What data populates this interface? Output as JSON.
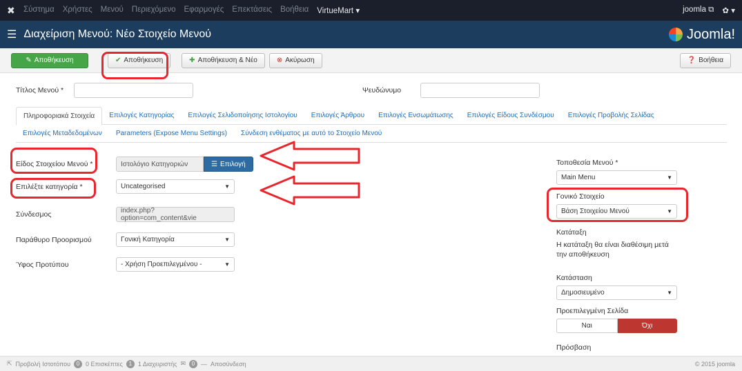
{
  "topbar": {
    "menu": [
      "Σύστημα",
      "Χρήστες",
      "Μενού",
      "Περιεχόμενο",
      "Εφαρμογές",
      "Επεκτάσεις",
      "Βοήθεια"
    ],
    "virtuemart": "VirtueMart ▾",
    "site_link": "joomla ⧉",
    "settings": "✿ ▾"
  },
  "titlebar": {
    "title": "Διαχείριση Μενού: Νέο Στοιχείο Μενού",
    "brand": "Joomla!"
  },
  "toolbar": {
    "save_close": "Αποθήκευση",
    "save": "Αποθήκευση",
    "save_new": "Αποθήκευση & Νέο",
    "cancel": "Ακύρωση",
    "help": "Βοήθεια"
  },
  "form": {
    "title_label": "Τίτλος Μενού *",
    "title_value": "",
    "alias_label": "Ψευδώνυμο",
    "alias_value": ""
  },
  "tabs_row1": [
    "Πληροφοριακά Στοιχεία",
    "Επιλογές Κατηγορίας",
    "Επιλογές Σελιδοποίησης Ιστολογίου",
    "Επιλογές Άρθρου",
    "Επιλογές Ενσωμάτωσης",
    "Επιλογές Είδους Συνδέσμου",
    "Επιλογές Προβολής Σελίδας"
  ],
  "tabs_row2": [
    "Επιλογές Μεταδεδομένων",
    "Parameters (Expose Menu Settings)",
    "Σύνδεση ενθέματος με αυτό το Στοιχείο Μενού"
  ],
  "fields": {
    "type_label": "Είδος Στοιχείου Μενού *",
    "type_value": "Ιστολόγιο Κατηγοριών",
    "type_button": "Επιλογή",
    "category_label": "Επιλέξτε κατηγορία *",
    "category_value": "Uncategorised",
    "link_label": "Σύνδεσμος",
    "link_value": "index.php?option=com_content&vie",
    "target_label": "Παράθυρο Προορισμού",
    "target_value": "Γονική Κατηγορία",
    "style_label": "Ύφος Προτύπου",
    "style_value": "- Χρήση Προεπιλεγμένου -"
  },
  "side": {
    "location_label": "Τοποθεσία Μενού *",
    "location_value": "Main Menu",
    "parent_label": "Γονικό Στοιχείο",
    "parent_value": "Βάση Στοιχείου Μενού",
    "order_label": "Κατάταξη",
    "order_note": "Η κατάταξη θα είναι διαθέσιμη μετά την αποθήκευση",
    "state_label": "Κατάσταση",
    "state_value": "Δημοσιευμένο",
    "default_label": "Προεπιλεγμένη Σελίδα",
    "default_no": "Ναι",
    "default_yes": "Όχι",
    "access_label": "Πρόσβαση"
  },
  "status": {
    "view_site": "Προβολή Ιστοτόπου",
    "visitors_count": "0",
    "visitors": "0 Επισκέπτες",
    "admins_count": "1",
    "admins": "1 Διαχειριστής",
    "messages_count": "0",
    "logout": "Αποσύνδεση",
    "copyright": "© 2015 joomla"
  },
  "colors": {
    "accent_red": "#e8262d",
    "header_blue": "#1c3d5e",
    "save_green": "#46a546"
  }
}
